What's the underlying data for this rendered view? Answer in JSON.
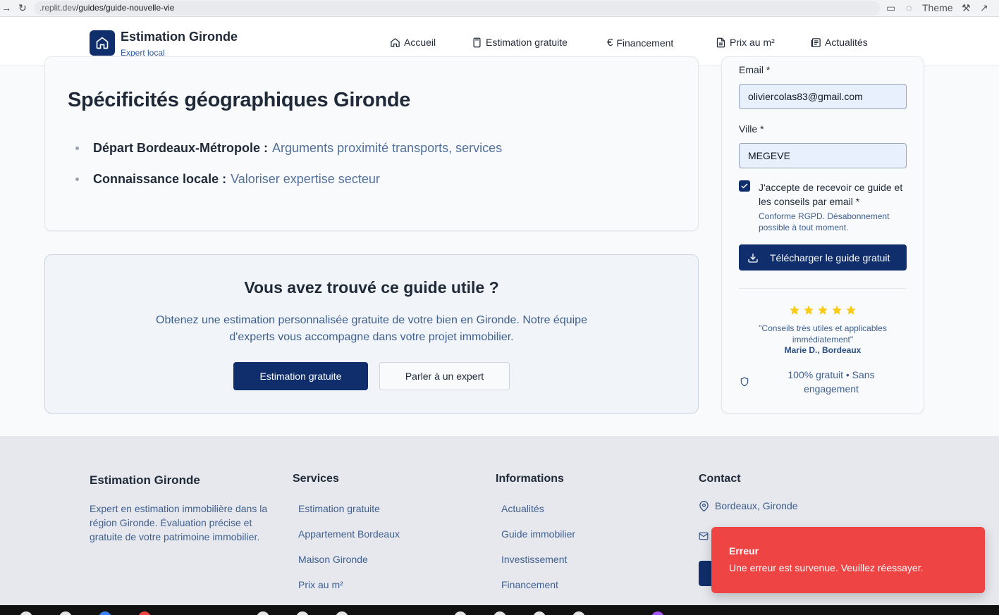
{
  "browser": {
    "url_prefix": ".replit.dev",
    "url_path": "/guides/guide-nouvelle-vie",
    "theme_label": "Theme"
  },
  "header": {
    "brand_title": "Estimation Gironde",
    "brand_subtitle": "Expert local",
    "nav": [
      {
        "label": "Accueil",
        "icon": "home-icon"
      },
      {
        "label": "Estimation gratuite",
        "icon": "calculator-icon"
      },
      {
        "label": "Financement",
        "icon": "euro-icon"
      },
      {
        "label": "Prix au m²",
        "icon": "document-icon"
      },
      {
        "label": "Actualités",
        "icon": "newspaper-icon"
      }
    ]
  },
  "geo": {
    "title": "Spécificités géographiques Gironde",
    "items": [
      {
        "label": "Départ Bordeaux-Métropole :",
        "text": "Arguments proximité transports, services"
      },
      {
        "label": "Connaissance locale :",
        "text": "Valoriser expertise secteur"
      }
    ]
  },
  "cta": {
    "title": "Vous avez trouvé ce guide utile ?",
    "text": "Obtenez une estimation personnalisée gratuite de votre bien en Gironde. Notre équipe d'experts vous accompagne dans votre projet immobilier.",
    "primary_button": "Estimation gratuite",
    "secondary_button": "Parler à un expert"
  },
  "form": {
    "email_label": "Email *",
    "email_value": "oliviercolas83@gmail.com",
    "city_label": "Ville *",
    "city_value": "MEGEVE",
    "consent_label": "J'accepte de recevoir ce guide et les conseils par email *",
    "consent_checked": true,
    "consent_note": "Conforme RGPD. Désabonnement possible à tout moment.",
    "download_button": "Télécharger le guide gratuit",
    "rating": 5,
    "testimonial": "\"Conseils très utiles et applicables immédiatement\"",
    "testimonial_author": "Marie D., Bordeaux",
    "free_note": "100% gratuit • Sans engagement"
  },
  "footer": {
    "brand_title": "Estimation Gironde",
    "brand_desc": "Expert en estimation immobilière dans la région Gironde. Évaluation précise et gratuite de votre patrimoine immobilier.",
    "services_title": "Services",
    "services": [
      "Estimation gratuite",
      "Appartement Bordeaux",
      "Maison Gironde",
      "Prix au m²"
    ],
    "info_title": "Informations",
    "info": [
      "Actualités",
      "Guide immobilier",
      "Investissement",
      "Financement"
    ],
    "contact_title": "Contact",
    "contact_location": "Bordeaux, Gironde"
  },
  "toast": {
    "title": "Erreur",
    "message": "Une erreur est survenue. Veuillez réessayer.",
    "color": "#ef4444"
  },
  "colors": {
    "primary": "#0f2e6b",
    "muted_text": "#3f5f8f",
    "star": "#facc15"
  }
}
